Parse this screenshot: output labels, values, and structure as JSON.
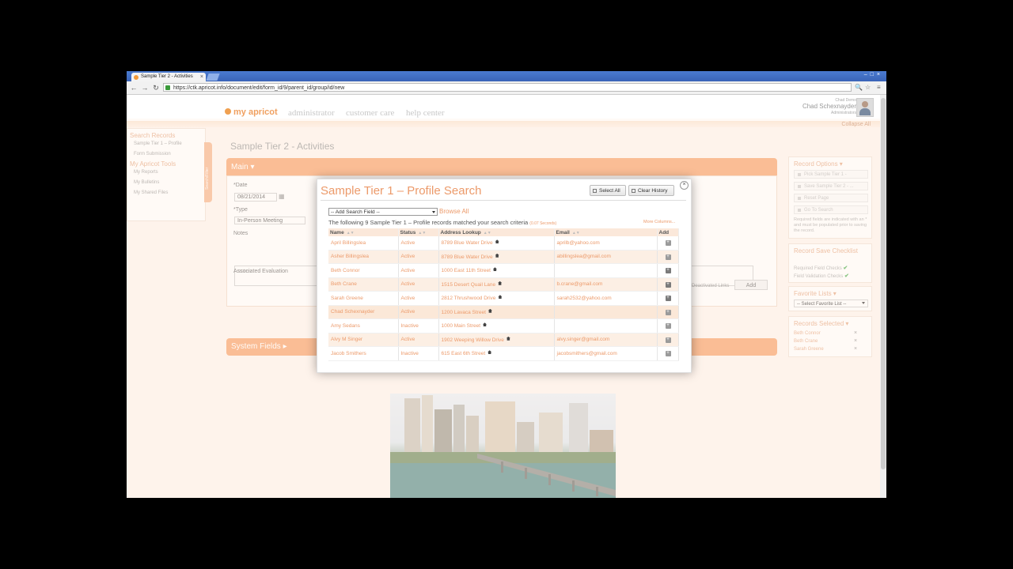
{
  "browser": {
    "tab_title": "Sample Tier 2 - Activities",
    "tab_close": "×",
    "window_controls": "–□×",
    "url": "https://ctk.apricot.info/document/edit/form_id/9/parent_id/group/id/new",
    "nav_back": "←",
    "nav_forward": "→",
    "nav_reload": "↻",
    "icon_zoom": "🔍",
    "icon_star": "☆",
    "icon_menu": "≡"
  },
  "header": {
    "logo": "my apricot",
    "nav": [
      "administrator",
      "customer care",
      "help center"
    ],
    "user_org": "Chad Demo",
    "user_name": "Chad Schexnayder",
    "user_role": "Administrators",
    "collapse_all": "Collapse All"
  },
  "left_sidebar": {
    "section1": "Search Records",
    "items1": [
      "Sample Tier 1 – Profile",
      "Form Submission"
    ],
    "section2": "My Apricot Tools",
    "items2": [
      "My Reports",
      "My Bulletins",
      "My Shared Files"
    ],
    "tab_label": "Search/Filter"
  },
  "main": {
    "page_title": "Sample Tier 2 - Activities",
    "section_main": "Main ▾",
    "date_label": "*Date",
    "date_value": "08/21/2014",
    "type_label": "*Type",
    "type_value": "In-Person Meeting",
    "notes_label": "Notes",
    "notes_placeholder": "notes",
    "assoc_label": "Associated Evaluation",
    "deactivated_links": "Deactivated Links",
    "add_label": "Add",
    "section_system": "System Fields ▸"
  },
  "right_sidebar": {
    "record_options": "Record Options ▾",
    "buttons": [
      "Pick Sample Tier 1 -",
      "Save Sample Tier 2 - ...",
      "Reset Page",
      "Go To Search"
    ],
    "required_note": "Required fields are indicated with an * and must be populated prior to saving the record.",
    "checklist_title": "Record Save Checklist",
    "checklist_items": [
      "Required Field Checks",
      "Field Validation Checks"
    ],
    "check_mark": "✔",
    "favorite_title": "Favorite Lists ▾",
    "favorite_select": "-- Select Favorite List --",
    "selected_title": "Records Selected ▾",
    "selected": [
      "Beth Connor",
      "Beth Crane",
      "Sarah Greene"
    ],
    "remove_mark": "×"
  },
  "modal": {
    "title": "Sample Tier 1 – Profile Search",
    "select_all": "Select All",
    "clear_history": "Clear History",
    "close": "×",
    "search_field": "-- Add Search Field --",
    "browse_all": "Browse All",
    "matched_text": "The following 9 Sample Tier 1 – Profile records matched your search criteria",
    "matched_secs": "(0.07 Seconds)",
    "more_columns": "More Columns...",
    "columns": [
      "Name",
      "Status",
      "Address Lookup",
      "Email",
      "Add"
    ],
    "add_icon": "+",
    "rows": [
      {
        "name": "April Billingslea",
        "status": "Active",
        "address": "8789 Blue Water Drive",
        "email": "aprilb@yahoo.com"
      },
      {
        "name": "Asher Billingslea",
        "status": "Active",
        "address": "8789 Blue Water Drive",
        "email": "abillingslea@gmail.com"
      },
      {
        "name": "Beth Connor",
        "status": "Active",
        "address": "1000 East 11th Street",
        "email": ""
      },
      {
        "name": "Beth Crane",
        "status": "Active",
        "address": "1515 Desert Quail Lane",
        "email": "b.crane@gmail.com"
      },
      {
        "name": "Sarah Greene",
        "status": "Active",
        "address": "2812 Thrushwood Drive",
        "email": "sarah2532@yahoo.com"
      },
      {
        "name": "Chad Schexnayder",
        "status": "Active",
        "address": "1200 Lavaca Street",
        "email": ""
      },
      {
        "name": "Amy Sedans",
        "status": "Inactive",
        "address": "1000 Main Street",
        "email": ""
      },
      {
        "name": "Alvy M Singer",
        "status": "Active",
        "address": "1902 Weeping Willow Drive",
        "email": "alvy.singer@gmail.com"
      },
      {
        "name": "Jacob Smithers",
        "status": "Inactive",
        "address": "615 East 6th Street",
        "email": "jacobsmithers@gmail.com"
      }
    ],
    "row_added": [
      false,
      false,
      true,
      true,
      true,
      false,
      false,
      false,
      false
    ]
  },
  "colors": {
    "accent": "#f7a26a",
    "link": "#ec9a6a"
  }
}
